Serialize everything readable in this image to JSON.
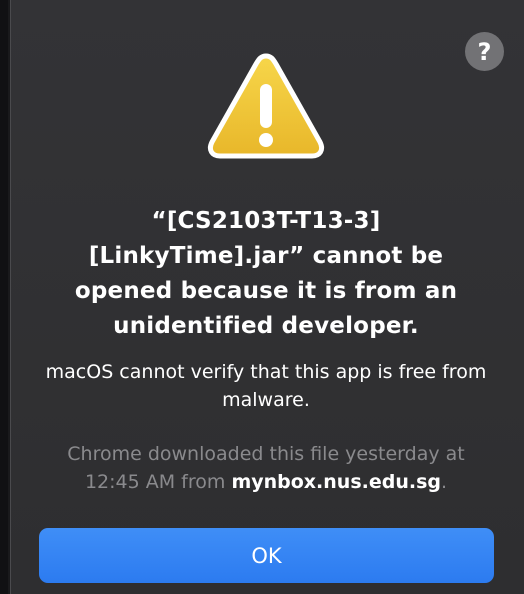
{
  "dialog": {
    "help_label": "?",
    "title": "“[CS2103T-T13-3] [LinkyTime].jar” cannot be opened because it is from an unidentified developer.",
    "message": "macOS cannot verify that this app is free from malware.",
    "info_prefix": "Chrome downloaded this file yesterday at 12:45 AM from ",
    "info_domain": "mynbox.nus.edu.sg",
    "info_suffix": ".",
    "ok_label": "OK",
    "icon": "warning-triangle-icon"
  },
  "colors": {
    "background": "#2e2e30",
    "accent": "#2c7bf0",
    "warning": "#f2c232",
    "secondary_text": "#8a8a8d"
  }
}
